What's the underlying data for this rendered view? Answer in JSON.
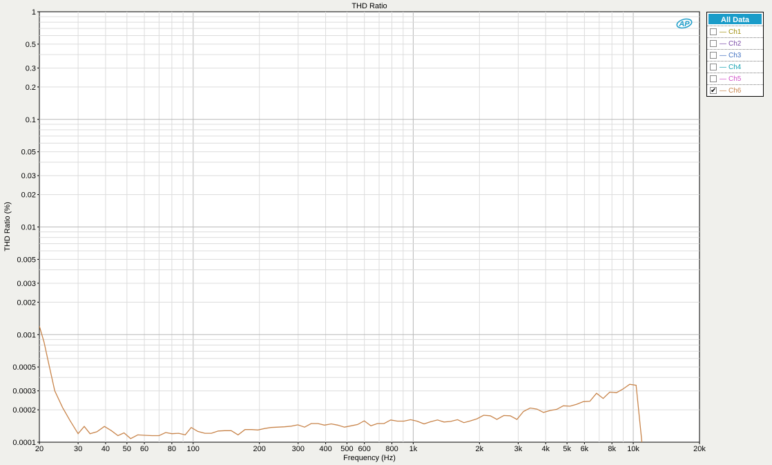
{
  "chart_data": {
    "type": "line",
    "title": "THD Ratio",
    "xlabel": "Frequency (Hz)",
    "ylabel": "THD Ratio (%)",
    "xscale": "log",
    "yscale": "log",
    "xlim": [
      20,
      20000
    ],
    "ylim": [
      0.0001,
      1
    ],
    "grid": true,
    "x_ticks": [
      {
        "value": 20,
        "label": "20"
      },
      {
        "value": 30,
        "label": "30"
      },
      {
        "value": 40,
        "label": "40"
      },
      {
        "value": 50,
        "label": "50"
      },
      {
        "value": 60,
        "label": "60"
      },
      {
        "value": 80,
        "label": "80"
      },
      {
        "value": 100,
        "label": "100"
      },
      {
        "value": 200,
        "label": "200"
      },
      {
        "value": 300,
        "label": "300"
      },
      {
        "value": 400,
        "label": "400"
      },
      {
        "value": 500,
        "label": "500"
      },
      {
        "value": 600,
        "label": "600"
      },
      {
        "value": 800,
        "label": "800"
      },
      {
        "value": 1000,
        "label": "1k"
      },
      {
        "value": 2000,
        "label": "2k"
      },
      {
        "value": 3000,
        "label": "3k"
      },
      {
        "value": 4000,
        "label": "4k"
      },
      {
        "value": 5000,
        "label": "5k"
      },
      {
        "value": 6000,
        "label": "6k"
      },
      {
        "value": 8000,
        "label": "8k"
      },
      {
        "value": 10000,
        "label": "10k"
      },
      {
        "value": 20000,
        "label": "20k"
      }
    ],
    "y_ticks": [
      {
        "value": 1,
        "label": "1"
      },
      {
        "value": 0.5,
        "label": "0.5"
      },
      {
        "value": 0.3,
        "label": "0.3"
      },
      {
        "value": 0.2,
        "label": "0.2"
      },
      {
        "value": 0.1,
        "label": "0.1"
      },
      {
        "value": 0.05,
        "label": "0.05"
      },
      {
        "value": 0.03,
        "label": "0.03"
      },
      {
        "value": 0.02,
        "label": "0.02"
      },
      {
        "value": 0.01,
        "label": "0.01"
      },
      {
        "value": 0.005,
        "label": "0.005"
      },
      {
        "value": 0.003,
        "label": "0.003"
      },
      {
        "value": 0.002,
        "label": "0.002"
      },
      {
        "value": 0.001,
        "label": "0.001"
      },
      {
        "value": 0.0005,
        "label": "0.0005"
      },
      {
        "value": 0.0003,
        "label": "0.0003"
      },
      {
        "value": 0.0002,
        "label": "0.0002"
      },
      {
        "value": 0.0001,
        "label": "0.0001"
      }
    ],
    "legend_position": "right",
    "series": [
      {
        "name": "Ch6",
        "color": "#c8844a",
        "x": [
          20,
          21,
          22,
          23.5,
          25.5,
          27.5,
          30,
          32,
          34,
          36.5,
          39.5,
          42.5,
          45.5,
          48.5,
          52,
          56,
          60,
          65,
          70,
          75,
          80,
          86,
          92,
          98,
          105,
          113,
          121,
          130,
          139,
          149,
          160,
          172,
          184,
          197,
          211,
          226,
          243,
          260,
          279,
          299,
          321,
          344,
          369,
          395,
          424,
          454,
          487,
          522,
          559,
          599,
          642,
          688,
          737,
          790,
          847,
          908,
          973,
          1040,
          1120,
          1200,
          1290,
          1380,
          1480,
          1590,
          1700,
          1820,
          1950,
          2090,
          2240,
          2400,
          2580,
          2760,
          2960,
          3170,
          3400,
          3650,
          3910,
          4190,
          4490,
          4810,
          5160,
          5530,
          5930,
          6350,
          6810,
          7300,
          7820,
          8380,
          8990,
          9630,
          10300,
          11000
        ],
        "y": [
          0.0012,
          0.00085,
          0.00055,
          0.0003,
          0.00021,
          0.00016,
          0.00012,
          0.00014,
          0.00012,
          0.000125,
          0.00014,
          0.000128,
          0.000115,
          0.000122,
          0.000108,
          0.000117,
          0.000116,
          0.000115,
          0.000115,
          0.000123,
          0.00012,
          0.000121,
          0.000117,
          0.000137,
          0.000126,
          0.000121,
          0.000121,
          0.000127,
          0.000128,
          0.000128,
          0.000117,
          0.000131,
          0.000131,
          0.00013,
          0.000134,
          0.000137,
          0.000138,
          0.000139,
          0.000141,
          0.000145,
          0.000138,
          0.000149,
          0.000149,
          0.000144,
          0.000148,
          0.000144,
          0.000138,
          0.000142,
          0.000146,
          0.000158,
          0.000142,
          0.000149,
          0.000149,
          0.000161,
          0.000157,
          0.000157,
          0.000162,
          0.000157,
          0.000148,
          0.000155,
          0.000161,
          0.000154,
          0.000156,
          0.000162,
          0.000152,
          0.000158,
          0.000165,
          0.000178,
          0.000176,
          0.000163,
          0.000177,
          0.000176,
          0.000163,
          0.000193,
          0.000208,
          0.000203,
          0.000189,
          0.000197,
          0.000202,
          0.000218,
          0.000216,
          0.000225,
          0.000238,
          0.00024,
          0.000285,
          0.000255,
          0.000292,
          0.000288,
          0.000312,
          0.000345,
          0.000338,
          9e-05
        ]
      }
    ]
  },
  "legend": {
    "header": "All Data",
    "items": [
      {
        "label": "Ch1",
        "color": "#a09010",
        "checked": false
      },
      {
        "label": "Ch2",
        "color": "#7a4aa8",
        "checked": false
      },
      {
        "label": "Ch3",
        "color": "#4070c0",
        "checked": false
      },
      {
        "label": "Ch4",
        "color": "#10a0b0",
        "checked": false
      },
      {
        "label": "Ch5",
        "color": "#d050c8",
        "checked": false
      },
      {
        "label": "Ch6",
        "color": "#c8844a",
        "checked": true
      }
    ]
  },
  "logo": {
    "text": "AP",
    "color": "#1a9cc9"
  },
  "checkmark_glyph": "✔",
  "swatch_glyph": "—"
}
